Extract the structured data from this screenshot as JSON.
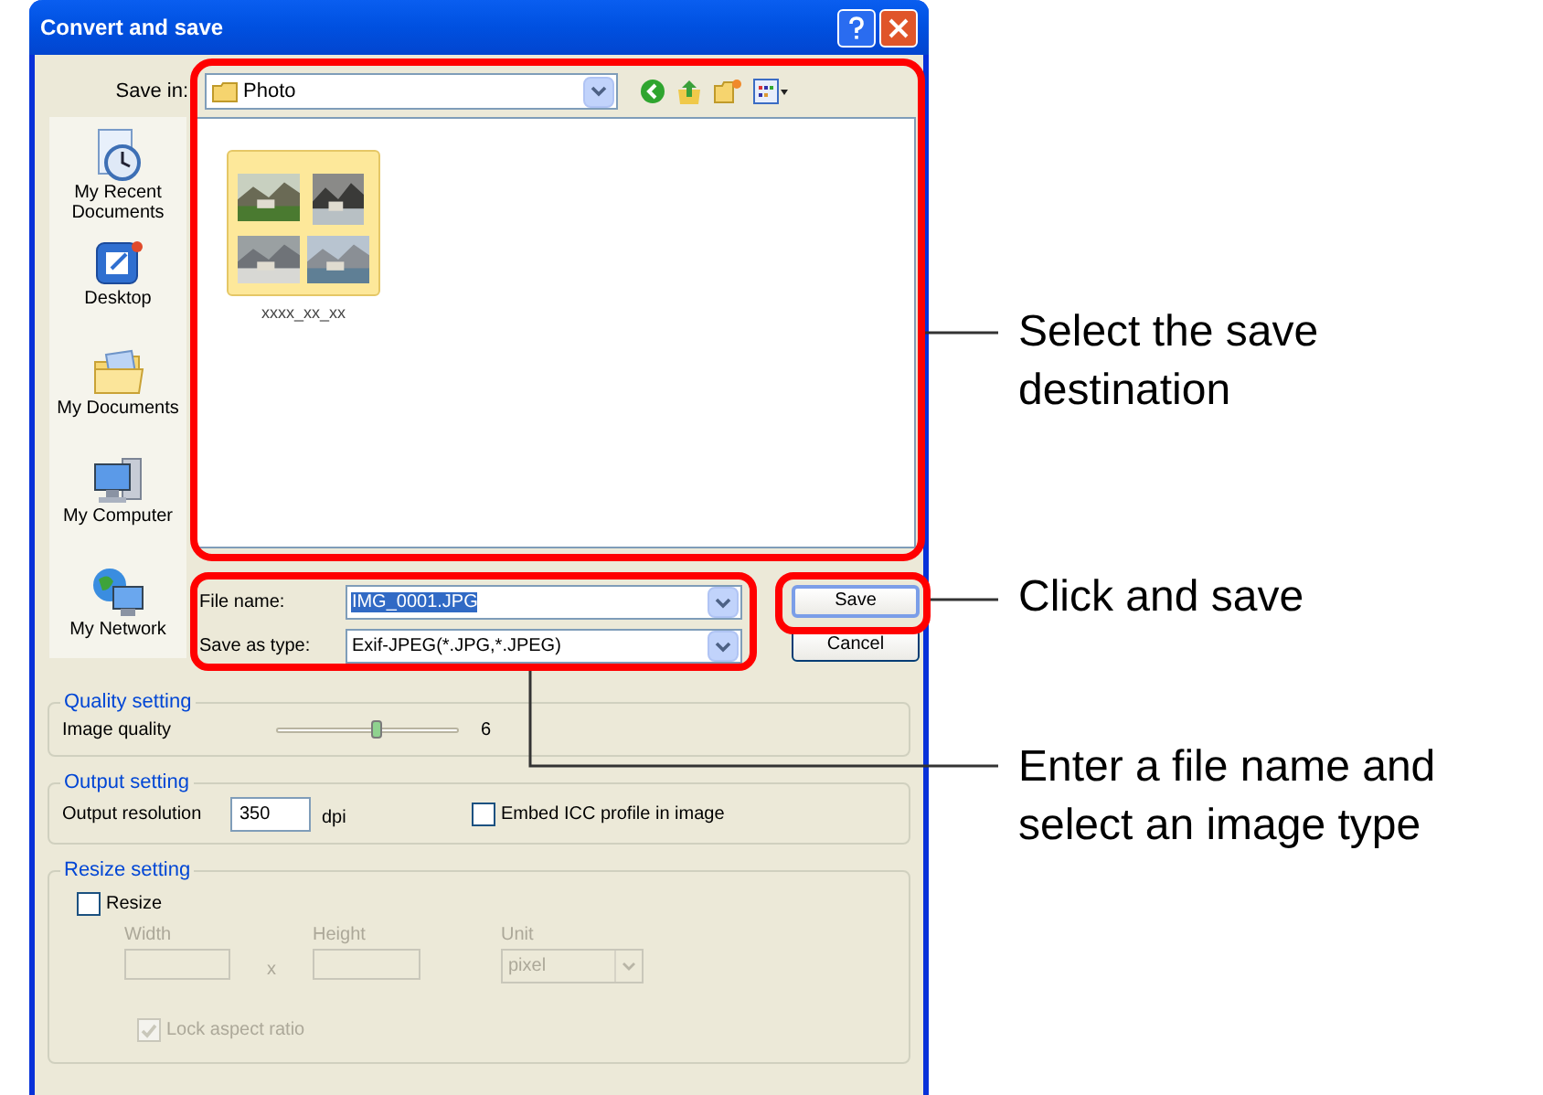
{
  "window": {
    "title": "Convert and save"
  },
  "save_in": {
    "label": "Save in:",
    "value": "Photo"
  },
  "places": [
    {
      "label": "My Recent Documents",
      "kind": "recent"
    },
    {
      "label": "Desktop",
      "kind": "desktop"
    },
    {
      "label": "My Documents",
      "kind": "documents"
    },
    {
      "label": "My Computer",
      "kind": "computer"
    },
    {
      "label": "My Network",
      "kind": "network"
    }
  ],
  "files": [
    {
      "name": "xxxx_xx_xx",
      "kind": "folder"
    }
  ],
  "file_name": {
    "label": "File name:",
    "value": "IMG_0001.JPG",
    "highlighted": true
  },
  "save_as_type": {
    "label": "Save as type:",
    "value": "Exif-JPEG(*.JPG,*.JPEG)"
  },
  "buttons": [
    {
      "label": "Save",
      "default": true
    },
    {
      "label": "Cancel",
      "default": false
    }
  ],
  "quality": {
    "title": "Quality setting",
    "label": "Image quality",
    "level": 0.55,
    "reading": "6"
  },
  "output": {
    "title": "Output setting",
    "label": "Output resolution",
    "value": "350",
    "unit": "dpi",
    "embed_icc": {
      "label": "Embed ICC profile in image",
      "checked": false
    }
  },
  "resize": {
    "title": "Resize setting",
    "resize": {
      "label": "Resize",
      "checked": false
    },
    "disabled": true,
    "width_label": "Width",
    "times": "x",
    "height_label": "Height",
    "unit_label": "Unit",
    "unit_value": "pixel",
    "lock": {
      "label": "Lock aspect ratio",
      "checked": true
    }
  },
  "annotations": [
    {
      "text": "Select the save destination"
    },
    {
      "text": "Click and save"
    },
    {
      "text": "Enter a file name and select an image type"
    }
  ]
}
